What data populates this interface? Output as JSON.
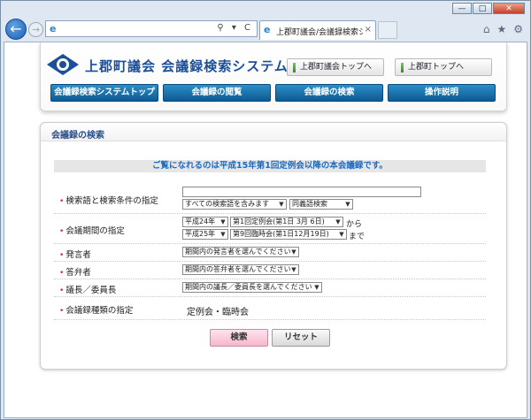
{
  "browser": {
    "tab_title": "上郡町議会/会議録検索シ...",
    "tab_close": "×",
    "address_tools": "⚲ ▾ C",
    "back_label": "←",
    "forward_label": "→",
    "window_buttons": [
      "—",
      "□",
      "✕"
    ],
    "right_icons": [
      "⌂",
      "★",
      "⚙"
    ]
  },
  "header": {
    "site_title": "上郡町議会 会議録検索システム",
    "top_links": [
      "上郡町議会トップへ",
      "上郡町トップへ"
    ],
    "nav": [
      "会議録検索システムトップ",
      "会議録の閲覧",
      "会議録の検索",
      "操作説明"
    ]
  },
  "panel": {
    "title": "会議録の検索",
    "notice": "ご覧になれるのは平成15年第1回定例会以降の本会議録です。",
    "rows": {
      "keyword": {
        "label": "検索語と検索条件の指定",
        "keyword_value": "",
        "condition": "すべての検索語を含みます",
        "synonym": "同義語検索"
      },
      "period": {
        "label": "会議期間の指定",
        "from_year": "平成24年",
        "from_session": "第1回定例会(第1日 3月 6日)",
        "from_suffix": "から",
        "to_year": "平成25年",
        "to_session": "第9回臨時会(第1日12月19日)",
        "to_suffix": "まで"
      },
      "speaker": {
        "label": "発言者",
        "select": "期間内の発言者を選んでください"
      },
      "answerer": {
        "label": "答弁者",
        "select": "期間内の答弁者を選んでください"
      },
      "chair": {
        "label": "議長／委員長",
        "select": "期間内の議長／委員長を選んでください"
      },
      "type": {
        "label": "会議録種類の指定",
        "value": "定例会・臨時会"
      }
    },
    "buttons": {
      "search": "検索",
      "reset": "リセット"
    }
  }
}
